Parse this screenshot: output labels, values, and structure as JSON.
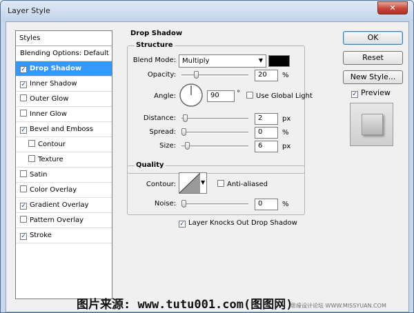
{
  "window": {
    "title": "Layer Style",
    "close_glyph": "✕"
  },
  "styles_panel": {
    "header": "Styles",
    "items": [
      {
        "label": "Blending Options: Default",
        "has_checkbox": false,
        "checked": false,
        "selected": false,
        "sub": false
      },
      {
        "label": "Drop Shadow",
        "has_checkbox": true,
        "checked": true,
        "selected": true,
        "sub": false
      },
      {
        "label": "Inner Shadow",
        "has_checkbox": true,
        "checked": true,
        "selected": false,
        "sub": false
      },
      {
        "label": "Outer Glow",
        "has_checkbox": true,
        "checked": false,
        "selected": false,
        "sub": false
      },
      {
        "label": "Inner Glow",
        "has_checkbox": true,
        "checked": false,
        "selected": false,
        "sub": false
      },
      {
        "label": "Bevel and Emboss",
        "has_checkbox": true,
        "checked": true,
        "selected": false,
        "sub": false
      },
      {
        "label": "Contour",
        "has_checkbox": true,
        "checked": false,
        "selected": false,
        "sub": true
      },
      {
        "label": "Texture",
        "has_checkbox": true,
        "checked": false,
        "selected": false,
        "sub": true
      },
      {
        "label": "Satin",
        "has_checkbox": true,
        "checked": false,
        "selected": false,
        "sub": false
      },
      {
        "label": "Color Overlay",
        "has_checkbox": true,
        "checked": false,
        "selected": false,
        "sub": false
      },
      {
        "label": "Gradient Overlay",
        "has_checkbox": true,
        "checked": true,
        "selected": false,
        "sub": false
      },
      {
        "label": "Pattern Overlay",
        "has_checkbox": true,
        "checked": false,
        "selected": false,
        "sub": false
      },
      {
        "label": "Stroke",
        "has_checkbox": true,
        "checked": true,
        "selected": false,
        "sub": false
      }
    ]
  },
  "drop_shadow": {
    "section_title": "Drop Shadow",
    "structure": {
      "title": "Structure",
      "blend_mode_label": "Blend Mode:",
      "blend_mode_value": "Multiply",
      "shadow_color": "#000000",
      "opacity_label": "Opacity:",
      "opacity_value": "20",
      "opacity_unit": "%",
      "angle_label": "Angle:",
      "angle_value": "90",
      "angle_unit": "°",
      "use_global_light_label": "Use Global Light",
      "use_global_light_checked": false,
      "distance_label": "Distance:",
      "distance_value": "2",
      "distance_unit": "px",
      "spread_label": "Spread:",
      "spread_value": "0",
      "spread_unit": "%",
      "size_label": "Size:",
      "size_value": "6",
      "size_unit": "px"
    },
    "quality": {
      "title": "Quality",
      "contour_label": "Contour:",
      "anti_aliased_label": "Anti-aliased",
      "anti_aliased_checked": false,
      "noise_label": "Noise:",
      "noise_value": "0",
      "noise_unit": "%"
    },
    "knocks_out_label": "Layer Knocks Out Drop Shadow",
    "knocks_out_checked": true
  },
  "buttons": {
    "ok": "OK",
    "reset": "Reset",
    "new_style": "New Style...",
    "preview_label": "Preview",
    "preview_checked": true
  },
  "watermark": {
    "main": "图片来源: www.tutu001.com(图图网)",
    "small": "思缘设计论坛 WWW.MISSYUAN.COM"
  }
}
